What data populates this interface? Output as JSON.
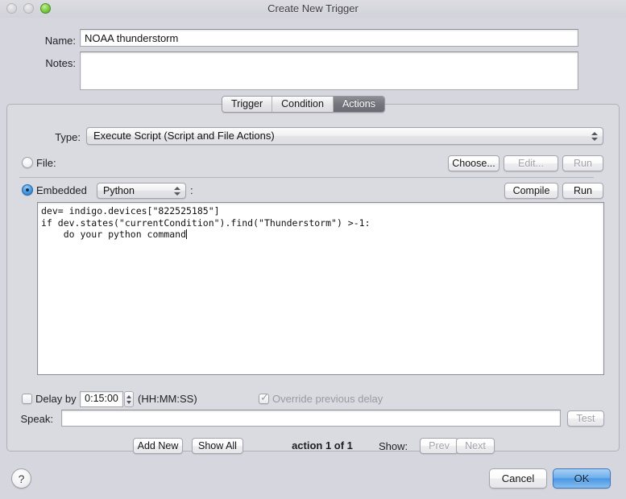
{
  "window": {
    "title": "Create New Trigger",
    "traffic_lights": [
      "close-button",
      "minimize-button",
      "zoom-button"
    ]
  },
  "form": {
    "name_label": "Name:",
    "name_value": "NOAA thunderstorm",
    "notes_label": "Notes:",
    "notes_value": ""
  },
  "tabs": [
    {
      "label": "Trigger",
      "selected": false
    },
    {
      "label": "Condition",
      "selected": false
    },
    {
      "label": "Actions",
      "selected": true
    }
  ],
  "actions_panel": {
    "type_label": "Type:",
    "type_value": "Execute Script (Script and File Actions)",
    "file_label": "File:",
    "file_selected": false,
    "embedded_label": "Embedded",
    "embedded_selected": true,
    "language_value": "Python",
    "language_colon": ":",
    "choose_label": "Choose...",
    "edit_label": "Edit...",
    "run_file_label": "Run",
    "compile_label": "Compile",
    "run_embedded_label": "Run",
    "code": "dev= indigo.devices[\"822525185\"]\nif dev.states(\"currentCondition\").find(\"Thunderstorm\") >-1:\n    do your python command"
  },
  "delay_row": {
    "delay_label": "Delay by",
    "delay_value": "0:15:00",
    "delay_format": "(HH:MM:SS)",
    "override_label": "Override previous delay",
    "delay_checked": false,
    "override_checked": true
  },
  "speak_row": {
    "speak_label": "Speak:",
    "speak_value": "",
    "test_label": "Test"
  },
  "nav_row": {
    "add_new_label": "Add New",
    "show_all_label": "Show All",
    "action_count": "action 1 of 1",
    "show_label": "Show:",
    "prev_label": "Prev",
    "next_label": "Next"
  },
  "footer": {
    "help_glyph": "?",
    "cancel_label": "Cancel",
    "ok_label": "OK"
  },
  "colors": {
    "window_background": "#d6d6de",
    "selected_tab": "#75757d",
    "default_button": "#4b97e4",
    "radio_selected": "#1d6fc4",
    "disabled_text": "#a3a3ab"
  }
}
